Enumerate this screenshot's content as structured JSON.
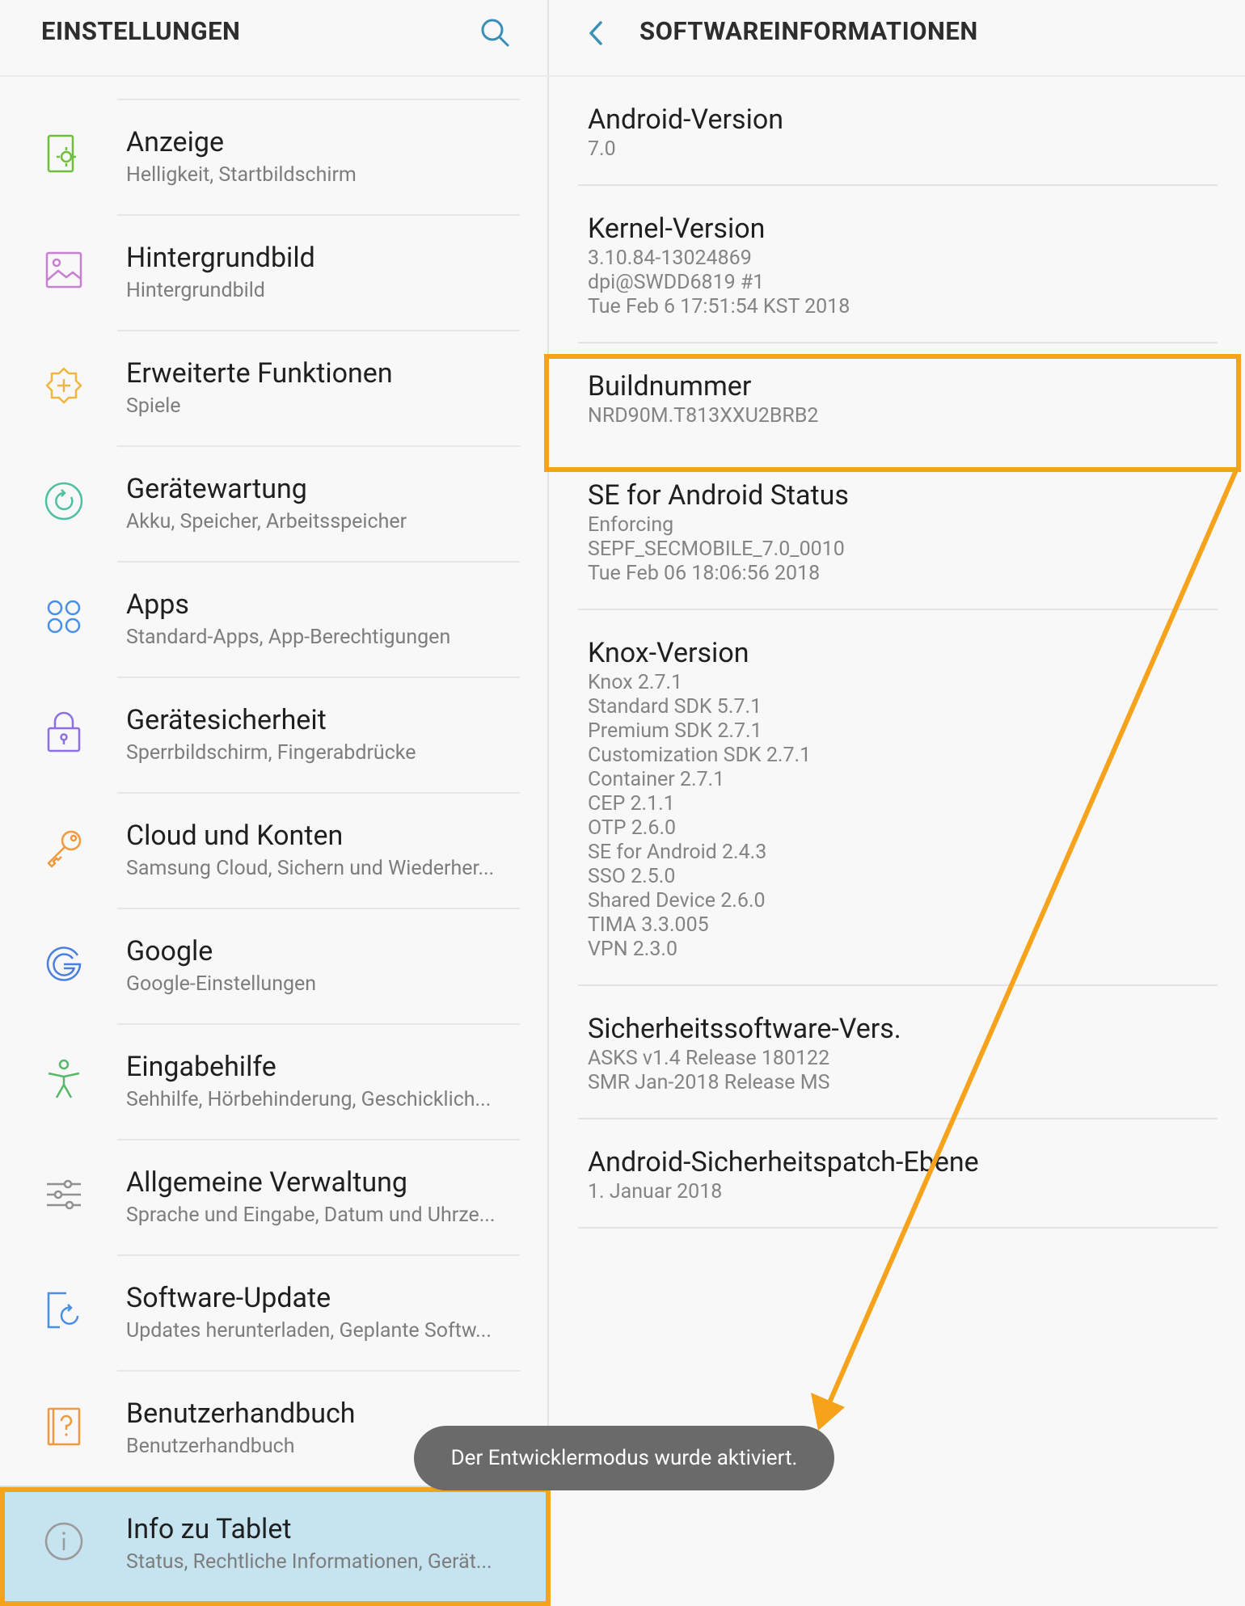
{
  "left_header": {
    "title": "EINSTELLUNGEN",
    "search_icon": "search-icon"
  },
  "right_header": {
    "title": "SOFTWAREINFORMATIONEN",
    "back_icon": "chevron-left-icon"
  },
  "menu": [
    {
      "title": "Anzeige",
      "subtitle": "Helligkeit, Startbildschirm",
      "icon": "display-icon",
      "color": "#6fbf3f"
    },
    {
      "title": "Hintergrundbild",
      "subtitle": "Hintergrundbild",
      "icon": "wallpaper-icon",
      "color": "#c77fd1"
    },
    {
      "title": "Erweiterte Funktionen",
      "subtitle": "Spiele",
      "icon": "advanced-features-icon",
      "color": "#f0b63c"
    },
    {
      "title": "Gerätewartung",
      "subtitle": "Akku, Speicher, Arbeitsspeicher",
      "icon": "device-maintenance-icon",
      "color": "#4fc0a0"
    },
    {
      "title": "Apps",
      "subtitle": "Standard-Apps, App-Berechtigungen",
      "icon": "apps-icon",
      "color": "#4a8fe7"
    },
    {
      "title": "Gerätesicherheit",
      "subtitle": "Sperrbildschirm, Fingerabdrücke",
      "icon": "lock-icon",
      "color": "#8c6fe0"
    },
    {
      "title": "Cloud und Konten",
      "subtitle": "Samsung Cloud, Sichern und Wiederher...",
      "icon": "key-icon",
      "color": "#f09a3c"
    },
    {
      "title": "Google",
      "subtitle": "Google-Einstellungen",
      "icon": "google-icon",
      "color": "#4a7fe0"
    },
    {
      "title": "Eingabehilfe",
      "subtitle": "Sehhilfe, Hörbehinderung, Geschicklich...",
      "icon": "accessibility-icon",
      "color": "#58b86a"
    },
    {
      "title": "Allgemeine Verwaltung",
      "subtitle": "Sprache und Eingabe, Datum und Uhrze...",
      "icon": "sliders-icon",
      "color": "#909090"
    },
    {
      "title": "Software-Update",
      "subtitle": "Updates herunterladen, Geplante Softw...",
      "icon": "software-update-icon",
      "color": "#4a8fe7"
    },
    {
      "title": "Benutzerhandbuch",
      "subtitle": "Benutzerhandbuch",
      "icon": "manual-icon",
      "color": "#f09a3c"
    },
    {
      "title": "Info zu Tablet",
      "subtitle": "Status, Rechtliche Informationen, Gerät...",
      "icon": "info-icon",
      "color": "#9a9a9a"
    }
  ],
  "info": [
    {
      "label": "Android-Version",
      "values": [
        "7.0"
      ]
    },
    {
      "label": "Kernel-Version",
      "values": [
        "3.10.84-13024869",
        "dpi@SWDD6819 #1",
        "Tue Feb 6 17:51:54 KST 2018"
      ]
    },
    {
      "label": "Buildnummer",
      "values": [
        "NRD90M.T813XXU2BRB2"
      ]
    },
    {
      "label": "SE for Android Status",
      "values": [
        "Enforcing",
        "SEPF_SECMOBILE_7.0_0010",
        "Tue Feb 06 18:06:56 2018"
      ]
    },
    {
      "label": "Knox-Version",
      "values": [
        "Knox 2.7.1",
        "Standard SDK 5.7.1",
        "Premium SDK 2.7.1",
        "Customization SDK 2.7.1",
        "Container 2.7.1",
        "CEP 2.1.1",
        "OTP 2.6.0",
        "SE for Android 2.4.3",
        "SSO 2.5.0",
        "Shared Device 2.6.0",
        "TIMA 3.3.005",
        "VPN 2.3.0"
      ]
    },
    {
      "label": "Sicherheitssoftware-Vers.",
      "values": [
        "ASKS v1.4 Release 180122",
        "SMR Jan-2018 Release MS"
      ]
    },
    {
      "label": "Android-Sicherheitspatch-Ebene",
      "values": [
        "1. Januar 2018"
      ]
    }
  ],
  "toast": {
    "text": "Der Entwicklermodus wurde aktiviert."
  },
  "annotation": {
    "color": "#f7a21b"
  }
}
